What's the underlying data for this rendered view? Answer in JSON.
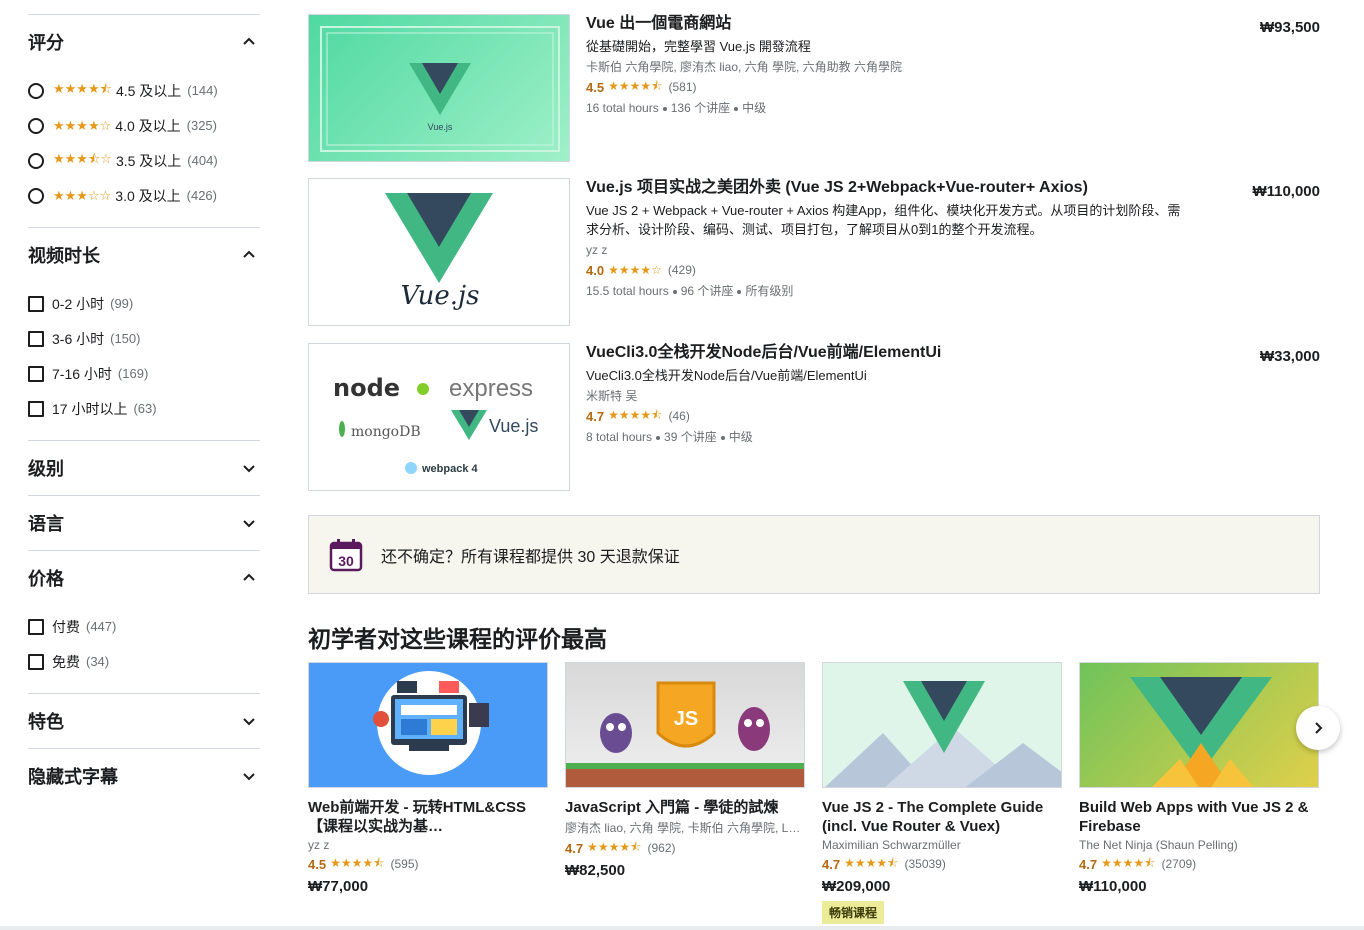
{
  "filters": {
    "rating": {
      "title": "评分",
      "options": [
        {
          "stars": "★★★★⯪",
          "label": "4.5 及以上",
          "count": "(144)"
        },
        {
          "stars": "★★★★☆",
          "label": "4.0 及以上",
          "count": "(325)"
        },
        {
          "stars": "★★★⯪☆",
          "label": "3.5 及以上",
          "count": "(404)"
        },
        {
          "stars": "★★★☆☆",
          "label": "3.0 及以上",
          "count": "(426)"
        }
      ]
    },
    "duration": {
      "title": "视频时长",
      "options": [
        {
          "label": "0-2 小时",
          "count": "(99)"
        },
        {
          "label": "3-6 小时",
          "count": "(150)"
        },
        {
          "label": "7-16 小时",
          "count": "(169)"
        },
        {
          "label": "17 小时以上",
          "count": "(63)"
        }
      ]
    },
    "level": {
      "title": "级别"
    },
    "language": {
      "title": "语言"
    },
    "price": {
      "title": "价格",
      "options": [
        {
          "label": "付费",
          "count": "(447)"
        },
        {
          "label": "免费",
          "count": "(34)"
        }
      ]
    },
    "features": {
      "title": "特色"
    },
    "subtitles": {
      "title": "隐藏式字幕"
    }
  },
  "courses": [
    {
      "title": "Vue 出一個電商網站",
      "desc": "從基礎開始，完整學習 Vue.js 開發流程",
      "instructor": "卡斯伯 六角學院, 廖洧杰 liao, 六角 學院, 六角助教 六角學院",
      "rating": "4.5",
      "stars": "★★★★⯪",
      "rating_count": "(581)",
      "hours": "16 total hours",
      "lectures": "136 个讲座",
      "level": "中级",
      "price": "₩93,500",
      "thumb_label": "Vue.js"
    },
    {
      "title": "Vue.js 项目实战之美团外卖 (Vue JS 2+Webpack+Vue-router+ Axios)",
      "desc": "Vue JS 2 + Webpack + Vue-router + Axios 构建App，组件化、模块化开发方式。从项目的计划阶段、需求分析、设计阶段、编码、测试、项目打包，了解项目从0到1的整个开发流程。",
      "instructor": "yz z",
      "rating": "4.0",
      "stars": "★★★★☆",
      "rating_count": "(429)",
      "hours": "15.5 total hours",
      "lectures": "96 个讲座",
      "level": "所有级别",
      "price": "₩110,000",
      "thumb_label": "Vue.js"
    },
    {
      "title": "VueCli3.0全栈开发Node后台/Vue前端/ElementUi",
      "desc": "VueCli3.0全栈开发Node后台/Vue前端/ElementUi",
      "instructor": "米斯特 吴",
      "rating": "4.7",
      "stars": "★★★★⯪",
      "rating_count": "(46)",
      "hours": "8 total hours",
      "lectures": "39 个讲座",
      "level": "中级",
      "price": "₩33,000",
      "thumb_labels": {
        "node": "node",
        "express": "express",
        "mongo": "mongoDB",
        "vue": "Vue.js",
        "webpack": "webpack 4"
      }
    }
  ],
  "guarantee": {
    "icon_number": "30",
    "text": "还不确定？所有课程都提供 30 天退款保证"
  },
  "section_title": "初学者对这些课程的评价最高",
  "cards": [
    {
      "title": "Web前端开发 - 玩转HTML&CSS【课程以实战为基…",
      "instructor": "yz z",
      "rating": "4.5",
      "stars": "★★★★⯪",
      "rating_count": "(595)",
      "price": "₩77,000"
    },
    {
      "title": "JavaScript 入門篇 - 學徒的試煉",
      "instructor": "廖洧杰 liao, 六角 學院, 卡斯伯 六角學院, Lei…",
      "rating": "4.7",
      "stars": "★★★★⯪",
      "rating_count": "(962)",
      "price": "₩82,500"
    },
    {
      "title": "Vue JS 2 - The Complete Guide (incl. Vue Router & Vuex)",
      "instructor": "Maximilian Schwarzmüller",
      "rating": "4.7",
      "stars": "★★★★⯪",
      "rating_count": "(35039)",
      "price": "₩209,000",
      "badge": "畅销课程"
    },
    {
      "title": "Build Web Apps with Vue JS 2 & Firebase",
      "instructor": "The Net Ninja (Shaun Pelling)",
      "rating": "4.7",
      "stars": "★★★★⯪",
      "rating_count": "(2709)",
      "price": "₩110,000"
    }
  ],
  "colors": {
    "accent_star": "#e59819",
    "rating_text": "#b4690e",
    "vue_green": "#41b883",
    "vue_dark": "#34495e"
  }
}
